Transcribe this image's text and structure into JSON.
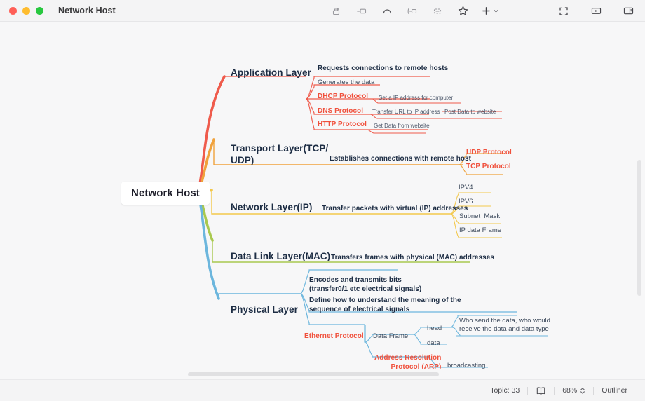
{
  "window": {
    "title": "Network Host",
    "traffic_lights": [
      "close",
      "minimize",
      "zoom"
    ]
  },
  "toolbar": {
    "center_items": [
      {
        "name": "insert-subtopic-icon",
        "label": "Subtopic"
      },
      {
        "name": "insert-sibling-topic-icon",
        "label": "Topic"
      },
      {
        "name": "insert-relationship-icon",
        "label": "Relationship"
      },
      {
        "name": "insert-boundary-icon",
        "label": "Boundary"
      },
      {
        "name": "insert-summary-icon",
        "label": "Summary"
      },
      {
        "name": "star-icon",
        "label": "Marker"
      },
      {
        "name": "add-icon",
        "label": "Insert"
      }
    ],
    "right_items": [
      {
        "name": "fullscreen-icon",
        "label": "Full Screen"
      },
      {
        "name": "presentation-icon",
        "label": "Presentation"
      },
      {
        "name": "toggle-sidebar-icon",
        "label": "Format Panel"
      }
    ]
  },
  "status": {
    "topic_label": "Topic: 33",
    "map_icon": "outline-map-icon",
    "zoom_level": "68%",
    "outliner_label": "Outliner"
  },
  "mindmap": {
    "root": "Network Host",
    "branches": [
      {
        "id": "application",
        "title": "Application Layer",
        "color": "#ef5b4c",
        "children": [
          {
            "text": "Requests connections to remote hosts",
            "style": "bold-dark"
          },
          {
            "text": "Generates the data",
            "style": "plain"
          },
          {
            "text": "DHCP Protocol",
            "style": "bold-red",
            "children": [
              {
                "text": "Set a IP address for computer",
                "style": "plain-sm"
              }
            ]
          },
          {
            "text": "DNS Protocol",
            "style": "bold-red",
            "children": [
              {
                "text": "Transfer URL to IP address",
                "style": "plain-sm"
              },
              {
                "text": "Post Data to website",
                "style": "plain-sm"
              }
            ]
          },
          {
            "text": "HTTP Protocol",
            "style": "bold-red",
            "children": [
              {
                "text": "Get Data from website",
                "style": "plain-sm"
              }
            ]
          }
        ]
      },
      {
        "id": "transport",
        "title": "Transport Layer(TCP/\nUDP)",
        "color": "#f0a23c",
        "children": [
          {
            "text": "Establishes connections with remote host",
            "style": "bold-dark",
            "children": [
              {
                "text": "UDP Protocol",
                "style": "bold-red"
              },
              {
                "text": "TCP Protocol",
                "style": "bold-red"
              }
            ]
          }
        ]
      },
      {
        "id": "network",
        "title": "Network Layer(IP)",
        "color": "#f3c84b",
        "children": [
          {
            "text": "Transfer packets with virtual (IP) addresses",
            "style": "bold-dark",
            "children": [
              {
                "text": "IPV4",
                "style": "plain"
              },
              {
                "text": "IPV6",
                "style": "plain"
              },
              {
                "text": "Subnet  Mask",
                "style": "plain"
              },
              {
                "text": "IP data Frame",
                "style": "plain"
              }
            ]
          }
        ]
      },
      {
        "id": "datalink",
        "title": "Data Link Layer(MAC)",
        "color": "#a9c94f",
        "children": [
          {
            "text": "Transfers frames with physical (MAC) addresses",
            "style": "bold-dark"
          }
        ]
      },
      {
        "id": "physical",
        "title": "Physical Layer",
        "color": "#6cb6dd",
        "children": [
          {
            "text": "Encodes and transmits bits\n(transfer0/1 etc electrical signals)",
            "style": "bold-dark"
          },
          {
            "text": "Define how to understand the meaning of the\nsequence of electrical signals",
            "style": "bold-dark"
          },
          {
            "text": "Ethernet Protocol",
            "style": "bold-red",
            "children": [
              {
                "text": "Data Frame",
                "style": "plain",
                "children": [
                  {
                    "text": "head",
                    "style": "plain",
                    "children": [
                      {
                        "text": "Who send the data, who would\nreceive the data and data type",
                        "style": "plain"
                      }
                    ]
                  },
                  {
                    "text": "data",
                    "style": "plain"
                  }
                ]
              },
              {
                "text": "Address Resolution\nProtocol (ARP)",
                "style": "bold-red",
                "children": [
                  {
                    "text": "broadcasting",
                    "style": "plain"
                  }
                ]
              }
            ]
          }
        ]
      }
    ]
  }
}
